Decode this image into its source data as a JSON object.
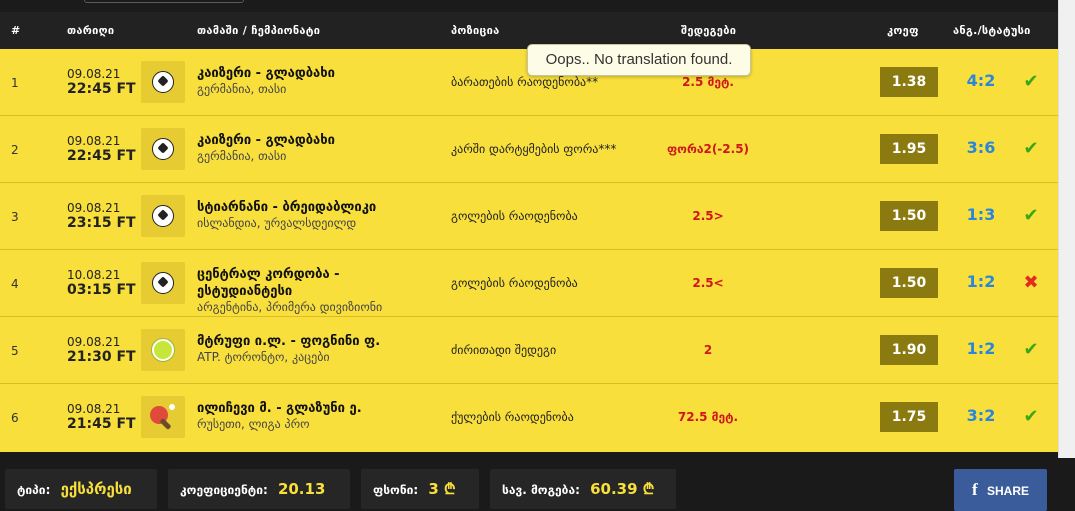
{
  "header": {
    "num": "#",
    "date": "თარიღი",
    "match": "თამაში / ჩემპიონატი",
    "position": "პოზიცია",
    "result": "შედეგები",
    "odds": "კოეფ",
    "score": "ანგ./სტატუსი"
  },
  "tooltip": "Oops.. No translation found.",
  "rows": [
    {
      "num": "1",
      "date": "09.08.21",
      "time": "22:45 FT",
      "sport": "football-icon",
      "match": "კაიზერი - გლადბახი",
      "league": "გერმანია, თასი",
      "position": "ბარათების რაოდენობა**",
      "result": "2.5 მეტ.",
      "odds": "1.38",
      "score": "4:2",
      "status": "win"
    },
    {
      "num": "2",
      "date": "09.08.21",
      "time": "22:45 FT",
      "sport": "football-icon",
      "match": "კაიზერი - გლადბახი",
      "league": "გერმანია, თასი",
      "position": "კარში დარტყმების ფორა***",
      "result": "ფორა2(-2.5)",
      "odds": "1.95",
      "score": "3:6",
      "status": "win"
    },
    {
      "num": "3",
      "date": "09.08.21",
      "time": "23:15 FT",
      "sport": "football-icon",
      "match": "სტიარნანი - ბრეიდაბლიკი",
      "league": "ისლანდია, ურვალსდეილდ",
      "position": "გოლების რაოდენობა",
      "result": "2.5>",
      "odds": "1.50",
      "score": "1:3",
      "status": "win"
    },
    {
      "num": "4",
      "date": "10.08.21",
      "time": "03:15 FT",
      "sport": "football-icon",
      "match": "ცენტრალ კორდობა - ესტუდიანტესი",
      "league": "არგენტინა, პრიმერა დივიზიონი",
      "position": "გოლების რაოდენობა",
      "result": "2.5<",
      "odds": "1.50",
      "score": "1:2",
      "status": "loss"
    },
    {
      "num": "5",
      "date": "09.08.21",
      "time": "21:30 FT",
      "sport": "tennis-ball-icon",
      "match": "მტრუფი ი.ლ. - ფოგნინი ფ.",
      "league": "ATP. ტორონტო, კაცები",
      "position": "ძირითადი შედეგი",
      "result": "2",
      "odds": "1.90",
      "score": "1:2",
      "status": "win"
    },
    {
      "num": "6",
      "date": "09.08.21",
      "time": "21:45 FT",
      "sport": "table-tennis-icon",
      "match": "ილიჩევი მ. - გლაზუნი ე.",
      "league": "რუსეთი, ლიგა პრო",
      "position": "ქულების რაოდენობა",
      "result": "72.5 მეტ.",
      "odds": "1.75",
      "score": "3:2",
      "status": "win"
    }
  ],
  "footer": {
    "type_label": "ტიპი:",
    "type_value": "ექსპრესი",
    "coef_label": "კოეფიციენტი:",
    "coef_value": "20.13",
    "stake_label": "ფსონი:",
    "stake_value": "3 ₾",
    "total_label": "სავ. მოგება:",
    "total_value": "60.39 ₾",
    "share_label": "SHARE"
  },
  "colors": {
    "row_bg": "#f8df3c",
    "odds_bg": "#8a7a0f",
    "score": "#2a86d8",
    "result": "#d0161a",
    "win": "#38a816",
    "loss": "#e22c20",
    "share": "#3b5c9a"
  }
}
